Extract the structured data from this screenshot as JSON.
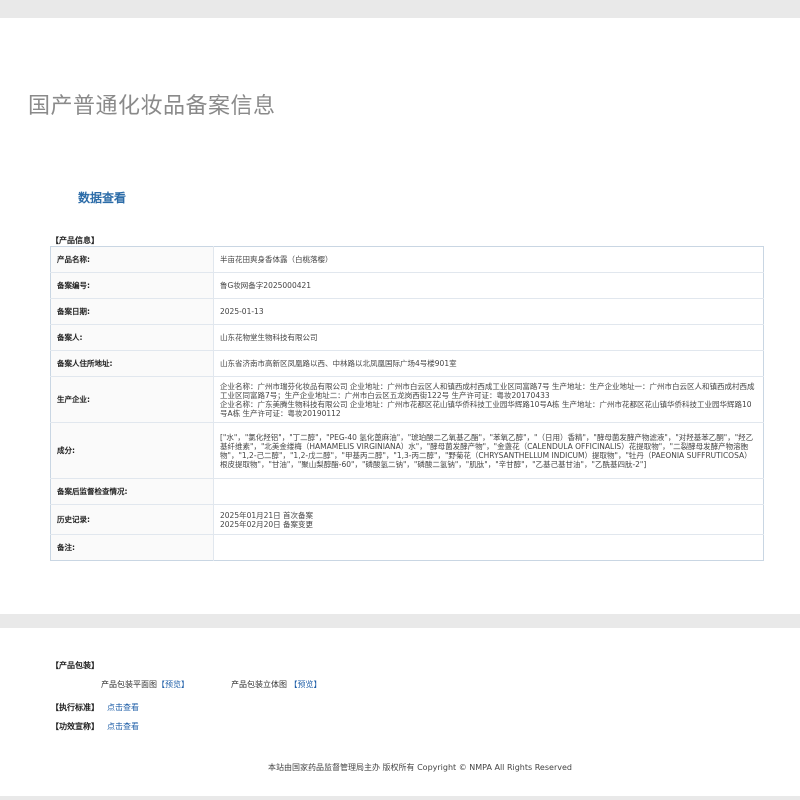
{
  "page": {
    "title": "国产普通化妆品备案信息",
    "section": "数据查看"
  },
  "product_info": {
    "label": "【产品信息】",
    "rows": [
      {
        "label": "产品名称:",
        "value": "半亩花田爽身香体露（白桃落樱）"
      },
      {
        "label": "备案编号:",
        "value": "鲁G妆网备字2025000421"
      },
      {
        "label": "备案日期:",
        "value": "2025-01-13"
      },
      {
        "label": "备案人:",
        "value": "山东花物堂生物科技有限公司"
      },
      {
        "label": "备案人住所地址:",
        "value": "山东省济南市高新区凤凰路以西、中林路以北凤凰国际广场4号楼901室"
      },
      {
        "label": "生产企业:",
        "value": "企业名称：广州市瑞芬化妆品有限公司 企业地址：广州市白云区人和镇西成村西成工业区同富路7号 生产地址：生产企业地址一：广州市白云区人和镇西成村西成工业区同富路7号；生产企业地址二：广州市白云区五龙岗西街122号 生产许可证：粤妆20170433\n企业名称：广东美腾生物科技有限公司 企业地址：广州市花都区花山镇华侨科技工业园华辉路10号A栋 生产地址：广州市花都区花山镇华侨科技工业园华辉路10号A栋 生产许可证：粤妆20190112"
      },
      {
        "label": "成分:",
        "value": "[\"水\"，\"氯化羟铝\"，\"丁二醇\"，\"PEG-40 氢化蓖麻油\"，\"琥珀酸二乙氧基乙酯\"，\"苯氧乙醇\"，\"（日用）香精\"，\"酵母菌发酵产物滤液\"，\"对羟基苯乙酮\"，\"羟乙基纤维素\"，\"北美金缕梅（HAMAMELIS VIRGINIANA）水\"，\"酵母菌发酵产物\"，\"金盏花（CALENDULA OFFICINALIS）花提取物\"，\"二裂酵母发酵产物溶胞物\"，\"1,2-己二醇\"，\"1,2-戊二醇\"，\"甲基丙二醇\"，\"1,3-丙二醇\"，\"野菊花（CHRYSANTHELLUM INDICUM）提取物\"，\"牡丹（PAEONIA SUFFRUTICOSA）根皮提取物\"，\"甘油\"，\"聚山梨醇酯-60\"，\"磷酸氢二钠\"，\"磷酸二氢钠\"，\"肌肽\"，\"辛甘醇\"，\"乙基己基甘油\"，\"乙酰基四肽-2\"]"
      },
      {
        "label": "备案后监督检查情况:",
        "value": ""
      },
      {
        "label": "历史记录:",
        "value": "2025年01月21日 首次备案\n2025年02月20日 备案变更"
      },
      {
        "label": "备注:",
        "value": ""
      }
    ]
  },
  "packaging": {
    "label": "【产品包装】",
    "flat_label": "产品包装平面图",
    "flat_link": "【预览】",
    "solid_label": "产品包装立体图",
    "solid_link": "【预览】"
  },
  "standard": {
    "label": "【执行标准】",
    "link": "点击查看"
  },
  "efficacy": {
    "label": "【功效宣称】",
    "link": "点击查看"
  },
  "footer": "本站由国家药品监督管理局主办 版权所有 Copyright © NMPA All Rights Reserved"
}
